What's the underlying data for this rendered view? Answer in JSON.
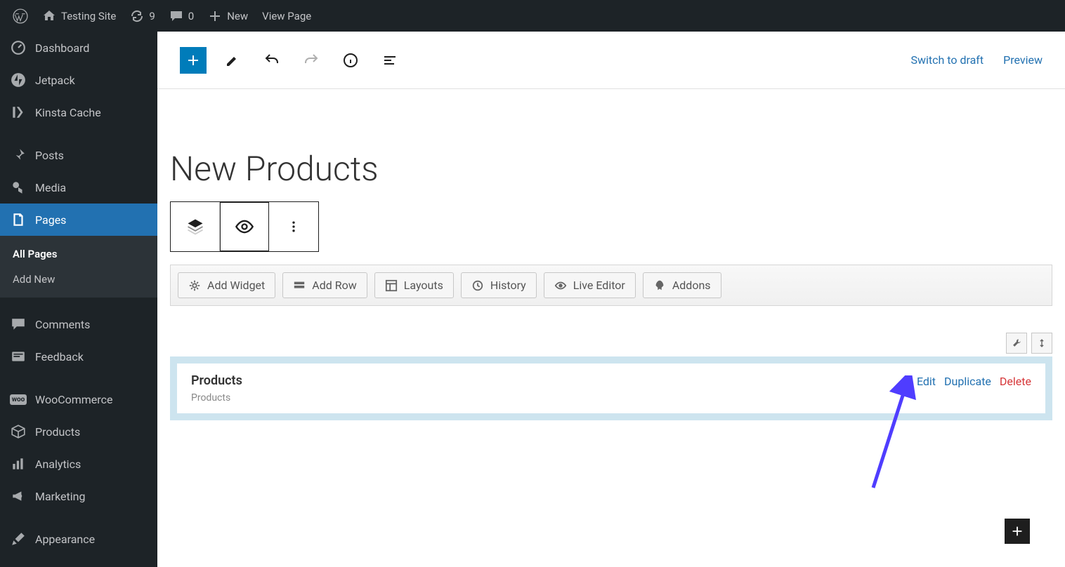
{
  "admin_bar": {
    "site_name": "Testing Site",
    "updates_count": "9",
    "comments_count": "0",
    "new_label": "New",
    "view_page_label": "View Page"
  },
  "sidebar": {
    "items": [
      {
        "label": "Dashboard",
        "icon": "dashboard"
      },
      {
        "label": "Jetpack",
        "icon": "jetpack"
      },
      {
        "label": "Kinsta Cache",
        "icon": "kinsta"
      },
      {
        "label": "Posts",
        "icon": "pin"
      },
      {
        "label": "Media",
        "icon": "media"
      },
      {
        "label": "Pages",
        "icon": "pages",
        "active": true
      },
      {
        "label": "Comments",
        "icon": "comments"
      },
      {
        "label": "Feedback",
        "icon": "feedback"
      },
      {
        "label": "WooCommerce",
        "icon": "woo"
      },
      {
        "label": "Products",
        "icon": "products"
      },
      {
        "label": "Analytics",
        "icon": "analytics"
      },
      {
        "label": "Marketing",
        "icon": "marketing"
      },
      {
        "label": "Appearance",
        "icon": "appearance"
      }
    ],
    "submenu": {
      "all_pages": "All Pages",
      "add_new": "Add New"
    }
  },
  "editor_toolbar": {
    "switch_to_draft": "Switch to draft",
    "preview": "Preview"
  },
  "page": {
    "title": "New Products"
  },
  "pb_toolbar": {
    "add_widget": "Add Widget",
    "add_row": "Add Row",
    "layouts": "Layouts",
    "history": "History",
    "live_editor": "Live Editor",
    "addons": "Addons"
  },
  "widget": {
    "title": "Products",
    "subtitle": "Products",
    "edit": "Edit",
    "duplicate": "Duplicate",
    "delete": "Delete"
  }
}
